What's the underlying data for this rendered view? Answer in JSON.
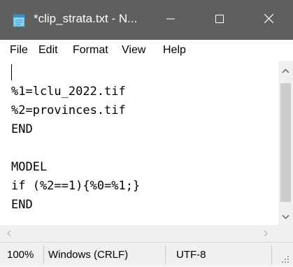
{
  "window": {
    "title": "*clip_strata.txt - N...",
    "icon": "notepad-icon",
    "controls": {
      "minimize": "minimize-icon",
      "maximize": "maximize-icon",
      "close": "close-icon"
    }
  },
  "menu": {
    "items": [
      "File",
      "Edit",
      "Format",
      "View",
      "Help"
    ]
  },
  "editor": {
    "lines": [
      "",
      "%1=lclu_2022.tif",
      "%2=provinces.tif",
      "END",
      "",
      "MODEL",
      "if (%2==1){%0=%1;}",
      "END"
    ]
  },
  "status": {
    "zoom": "100%",
    "line_ending": "Windows (CRLF)",
    "encoding": "UTF-8"
  },
  "colors": {
    "titlebar": "#5f5f5f",
    "chrome": "#f0f0f0",
    "scroll_thumb": "#cdcdcd"
  }
}
